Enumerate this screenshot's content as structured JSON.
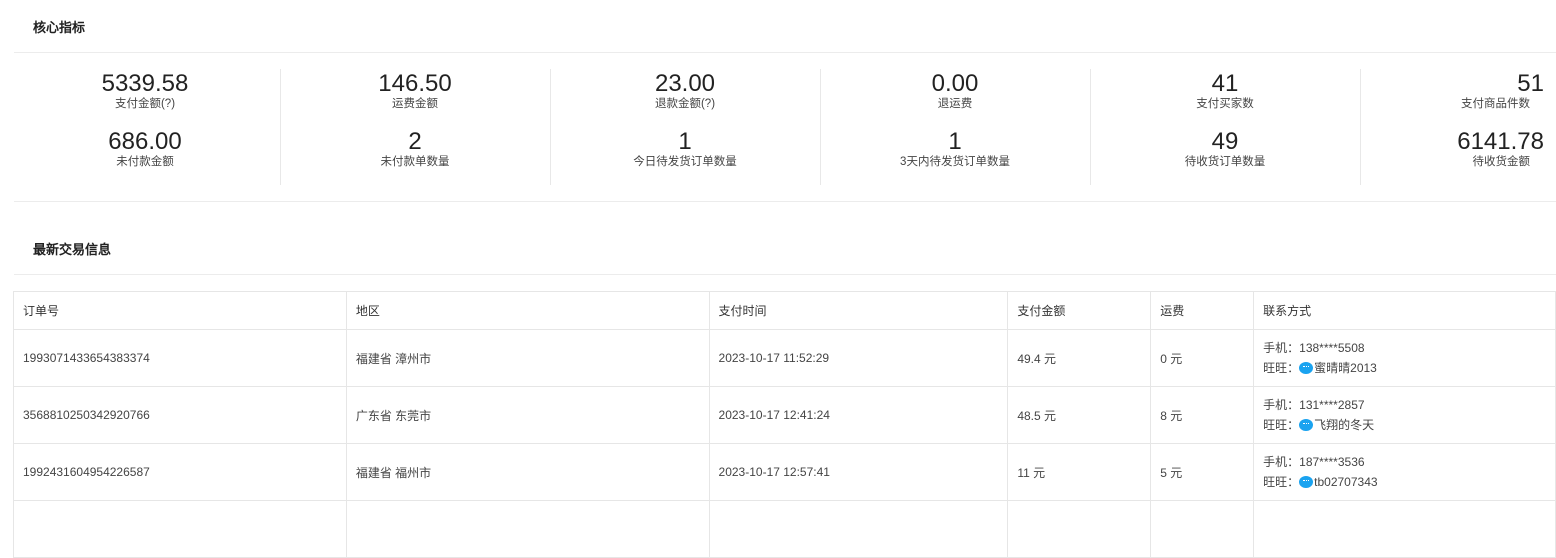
{
  "core": {
    "title": "核心指标",
    "columns": [
      {
        "top": {
          "value": "5339.58",
          "label": "支付金额(?)"
        },
        "bottom": {
          "value": "686.00",
          "label": "未付款金额"
        }
      },
      {
        "top": {
          "value": "146.50",
          "label": "运费金额"
        },
        "bottom": {
          "value": "2",
          "label": "未付款单数量"
        }
      },
      {
        "top": {
          "value": "23.00",
          "label": "退款金额(?)"
        },
        "bottom": {
          "value": "1",
          "label": "今日待发货订单数量"
        }
      },
      {
        "top": {
          "value": "0.00",
          "label": "退运费"
        },
        "bottom": {
          "value": "1",
          "label": "3天内待发货订单数量"
        }
      },
      {
        "top": {
          "value": "41",
          "label": "支付买家数"
        },
        "bottom": {
          "value": "49",
          "label": "待收货订单数量"
        }
      },
      {
        "top": {
          "value": "51",
          "label": "支付商品件数"
        },
        "bottom": {
          "value": "6141.78",
          "label": "待收货金额"
        }
      }
    ]
  },
  "latest": {
    "title": "最新交易信息",
    "headers": [
      "订单号",
      "地区",
      "支付时间",
      "支付金额",
      "运费",
      "联系方式"
    ],
    "rows": [
      {
        "order": "1993071433654383374",
        "region": "福建省 漳州市",
        "time": "2023-10-17 11:52:29",
        "amount": "49.4 元",
        "freight": "0 元",
        "phone": "手机：138****5508",
        "wangwang_label": "旺旺：",
        "wangwang": "蜜晴晴2013"
      },
      {
        "order": "3568810250342920766",
        "region": "广东省 东莞市",
        "time": "2023-10-17 12:41:24",
        "amount": "48.5 元",
        "freight": "8 元",
        "phone": "手机：131****2857",
        "wangwang_label": "旺旺：",
        "wangwang": "飞翔的冬天"
      },
      {
        "order": "1992431604954226587",
        "region": "福建省 福州市",
        "time": "2023-10-17 12:57:41",
        "amount": "11 元",
        "freight": "5 元",
        "phone": "手机：187****3536",
        "wangwang_label": "旺旺：",
        "wangwang": "tb02707343"
      }
    ]
  }
}
